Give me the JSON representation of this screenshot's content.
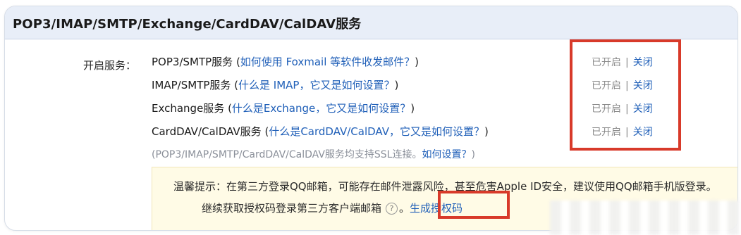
{
  "header": {
    "title": "POP3/IMAP/SMTP/Exchange/CardDAV/CalDAV服务"
  },
  "services_label": "开启服务：",
  "services": [
    {
      "name": "POP3/SMTP服务",
      "open": " (",
      "help": "如何使用 Foxmail 等软件收发邮件？",
      "close": ")",
      "status": "已开启",
      "sep": "|",
      "action": "关闭"
    },
    {
      "name": "IMAP/SMTP服务",
      "open": " (",
      "help": "什么是 IMAP，它又是如何设置？",
      "close": ")",
      "status": "已开启",
      "sep": "|",
      "action": "关闭"
    },
    {
      "name": "Exchange服务",
      "open": " (",
      "help": "什么是Exchange，它又是如何设置？",
      "close": ")",
      "status": "已开启",
      "sep": "|",
      "action": "关闭"
    },
    {
      "name": "CardDAV/CalDAV服务",
      "open": " (",
      "help": "什么是CardDAV/CalDAV，它又是如何设置？",
      "close": ")",
      "status": "已开启",
      "sep": "|",
      "action": "关闭"
    }
  ],
  "ssl_note": {
    "text": "(POP3/IMAP/SMTP/CardDAV/CalDAV服务均支持SSL连接。",
    "link": "如何设置？",
    "end": ")"
  },
  "notice": {
    "line1": "温馨提示：在第三方登录QQ邮箱，可能存在邮件泄露风险，甚至危害Apple ID安全，建议使用QQ邮箱手机版登录。",
    "line2": "继续获取授权码登录第三方客户端邮箱",
    "help_icon": "?",
    "period": "。",
    "auth_link": "生成授权码"
  },
  "colors": {
    "header_bg": "#e8eef8",
    "link": "#1f5fb8",
    "highlight_border": "#d83a2a",
    "notice_bg": "#fffbe6"
  }
}
